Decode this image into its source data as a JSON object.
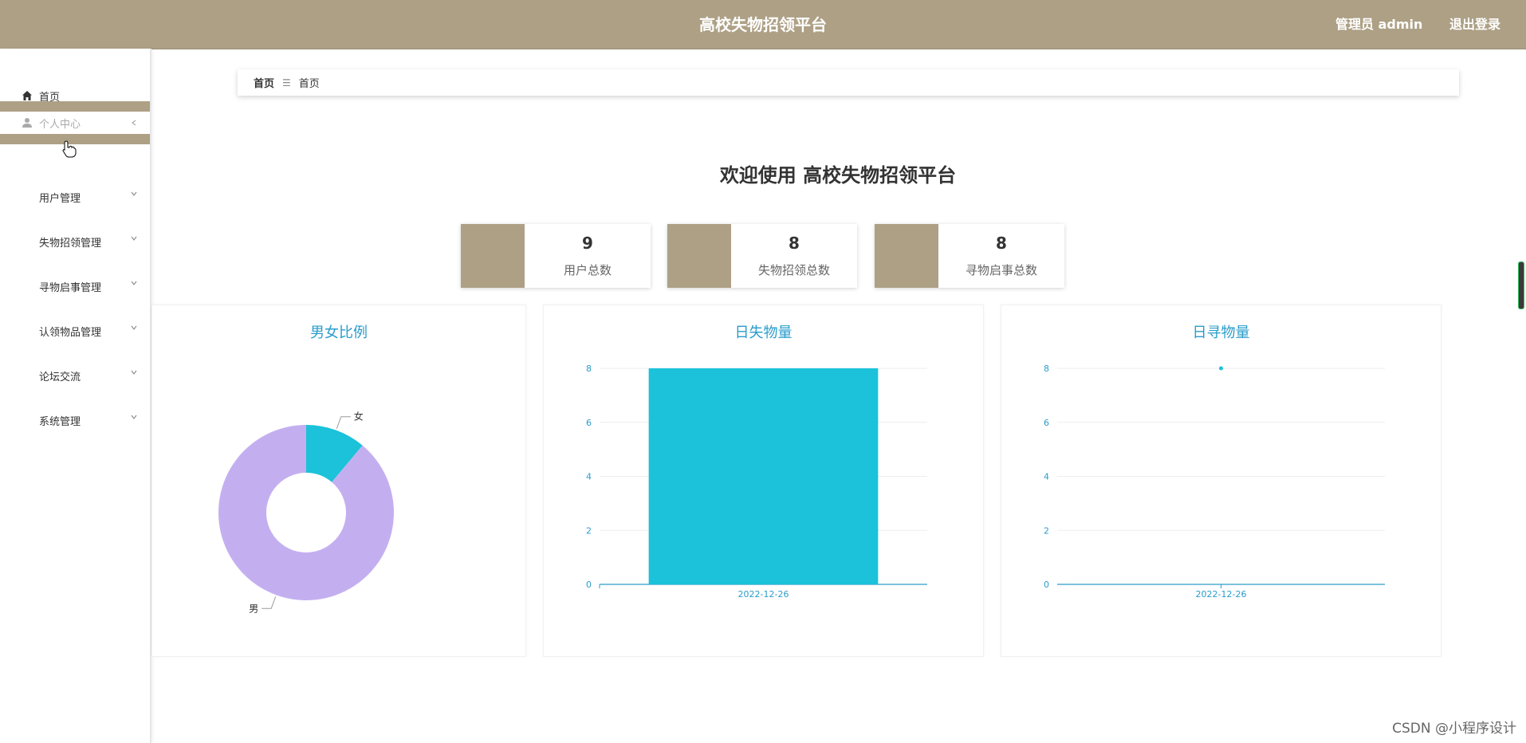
{
  "header": {
    "app_title": "高校失物招领平台",
    "admin_label": "管理员 admin",
    "logout_label": "退出登录"
  },
  "sidebar": {
    "items": [
      {
        "label": "首页",
        "icon": "home-icon"
      },
      {
        "label": "个人中心",
        "icon": "user-icon",
        "active": true
      },
      {
        "label": "用户管理",
        "icon": "grid-icon"
      },
      {
        "label": "失物招领管理",
        "icon": "grid-icon"
      },
      {
        "label": "寻物启事管理",
        "icon": "grid-icon"
      },
      {
        "label": "认领物品管理",
        "icon": "grid-icon"
      },
      {
        "label": "论坛交流",
        "icon": "grid-icon"
      },
      {
        "label": "系统管理",
        "icon": "grid-icon"
      }
    ]
  },
  "breadcrumb": {
    "root": "首页",
    "current": "首页"
  },
  "welcome": "欢迎使用 高校失物招领平台",
  "stats": [
    {
      "value": "9",
      "label": "用户总数"
    },
    {
      "value": "8",
      "label": "失物招领总数"
    },
    {
      "value": "8",
      "label": "寻物启事总数"
    }
  ],
  "colors": {
    "accent": "#ada085",
    "chart_title": "#2a9ccb",
    "bar": "#1bc2d9",
    "female": "#1bc2d9",
    "male": "#c3aff0"
  },
  "chart_data": [
    {
      "type": "pie",
      "title": "男女比例",
      "donut": true,
      "slices": [
        {
          "name": "女",
          "value": 1
        },
        {
          "name": "男",
          "value": 8
        }
      ]
    },
    {
      "type": "bar",
      "title": "日失物量",
      "categories": [
        "2022-12-26"
      ],
      "values": [
        8
      ],
      "ylim": [
        0,
        8
      ],
      "yticks": [
        0,
        2,
        4,
        6,
        8
      ]
    },
    {
      "type": "line",
      "title": "日寻物量",
      "categories": [
        "2022-12-26"
      ],
      "values": [
        8
      ],
      "ylim": [
        0,
        8
      ],
      "yticks": [
        0,
        2,
        4,
        6,
        8
      ]
    }
  ],
  "watermark": "CSDN @小程序设计"
}
